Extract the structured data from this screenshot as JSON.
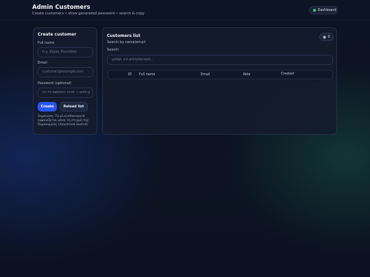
{
  "header": {
    "title": "Admin Customers",
    "subtitle": "Create customers • show generated password • search & copy",
    "dashboard_label": "Dashboard"
  },
  "create_form": {
    "title": "Create customer",
    "full_name_label": "Full name",
    "full_name_placeholder": "π.χ. Δήμος Κουλάδας",
    "email_label": "Email",
    "email_placeholder": "customer@example.com",
    "password_label": "Password (optional)",
    "password_placeholder": "αν το αφήσεις κενό → auto-g",
    "create_label": "Create",
    "reload_label": "Reload list",
    "note_prefix": "Σημείωση: Το ",
    "note_code": "plainPassword",
    "note_suffix": " εμφανίζεται μόνο τη στιγμή της δημιουργίας (λογιστικά σωστό)."
  },
  "customers_list": {
    "title": "Customers list",
    "subtitle": "Search by name/email",
    "count": "0",
    "count_icon": "shield-icon",
    "search_label": "Search",
    "search_placeholder": "γράψε για φιλτράρισμα...",
    "columns": [
      "ID",
      "Full name",
      "Email",
      "Role",
      "Created"
    ],
    "rows": []
  },
  "colors": {
    "accent": "#2a55f0",
    "status_dot": "#35d07f",
    "card_bg": "#141b2c"
  }
}
